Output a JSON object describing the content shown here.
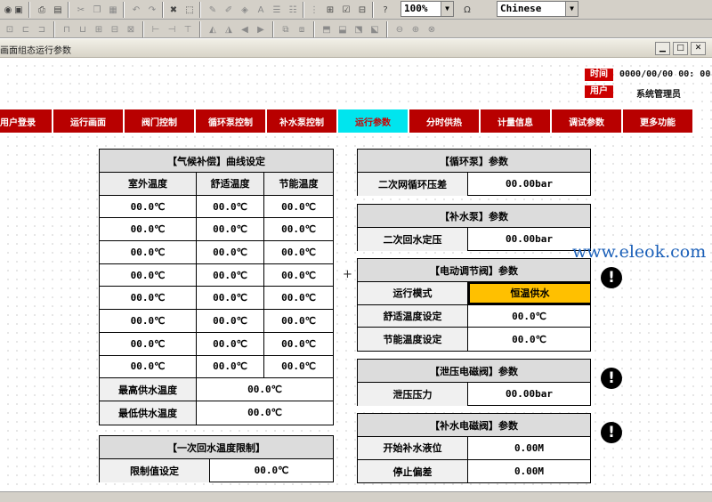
{
  "toolbar": {
    "zoom": "100%",
    "language": "Chinese",
    "icons": [
      "app-icon",
      "save-icon",
      "print-icon",
      "print-preview-icon",
      "cut-icon",
      "copy-icon",
      "paste-icon",
      "undo-icon",
      "redo-icon",
      "tools-icon",
      "select-icon",
      "draw-icon",
      "edit-icon",
      "style-icon",
      "text-icon",
      "list-icon",
      "grid-icon",
      "export-icon",
      "check-icon",
      "import-icon",
      "help-icon",
      "unit-icon"
    ]
  },
  "window": {
    "title": "画面组态运行参数"
  },
  "header": {
    "time_label": "时间",
    "time_value": "0000/00/00 00: 00",
    "user_label": "用户",
    "user_value": "系统管理员"
  },
  "nav": {
    "items": [
      {
        "label": "用户登录"
      },
      {
        "label": "运行画面"
      },
      {
        "label": "阀门控制"
      },
      {
        "label": "循环泵控制"
      },
      {
        "label": "补水泵控制"
      },
      {
        "label": "运行参数",
        "active": true
      },
      {
        "label": "分时供热"
      },
      {
        "label": "计量信息"
      },
      {
        "label": "调试参数"
      },
      {
        "label": "更多功能"
      }
    ]
  },
  "climate": {
    "title": "【气候补偿】曲线设定",
    "headers": [
      "室外温度",
      "舒适温度",
      "节能温度"
    ],
    "rows": [
      [
        "00.0℃",
        "00.0℃",
        "00.0℃"
      ],
      [
        "00.0℃",
        "00.0℃",
        "00.0℃"
      ],
      [
        "00.0℃",
        "00.0℃",
        "00.0℃"
      ],
      [
        "00.0℃",
        "00.0℃",
        "00.0℃"
      ],
      [
        "00.0℃",
        "00.0℃",
        "00.0℃"
      ],
      [
        "00.0℃",
        "00.0℃",
        "00.0℃"
      ],
      [
        "00.0℃",
        "00.0℃",
        "00.0℃"
      ],
      [
        "00.0℃",
        "00.0℃",
        "00.0℃"
      ]
    ],
    "max_label": "最高供水温度",
    "max_value": "00.0℃",
    "min_label": "最低供水温度",
    "min_value": "00.0℃"
  },
  "return_limit": {
    "title": "【一次回水温度限制】",
    "label": "限制值设定",
    "value": "00.0℃"
  },
  "circ_pump": {
    "title": "【循环泵】参数",
    "label": "二次网循环压差",
    "value": "00.00bar"
  },
  "makeup_pump": {
    "title": "【补水泵】参数",
    "label": "二次回水定压",
    "value": "00.00bar"
  },
  "valve": {
    "title": "【电动调节阀】参数",
    "rows": [
      {
        "label": "运行模式",
        "value": "恒温供水"
      },
      {
        "label": "舒适温度设定",
        "value": "00.0℃"
      },
      {
        "label": "节能温度设定",
        "value": "00.0℃"
      }
    ]
  },
  "relief_valve": {
    "title": "【泄压电磁阀】参数",
    "label": "泄压压力",
    "value": "00.00bar"
  },
  "makeup_valve": {
    "title": "【补水电磁阀】参数",
    "rows": [
      {
        "label": "开始补水液位",
        "value": "0.00M"
      },
      {
        "label": "停止偏差",
        "value": "0.00M"
      }
    ]
  },
  "warning_symbol": "!",
  "watermark": "www.eleok.com",
  "colors": {
    "nav_bg": "#b80000",
    "nav_active": "#00e5ee",
    "tag_red": "#cc0000",
    "mode_orange": "#ffc000"
  }
}
